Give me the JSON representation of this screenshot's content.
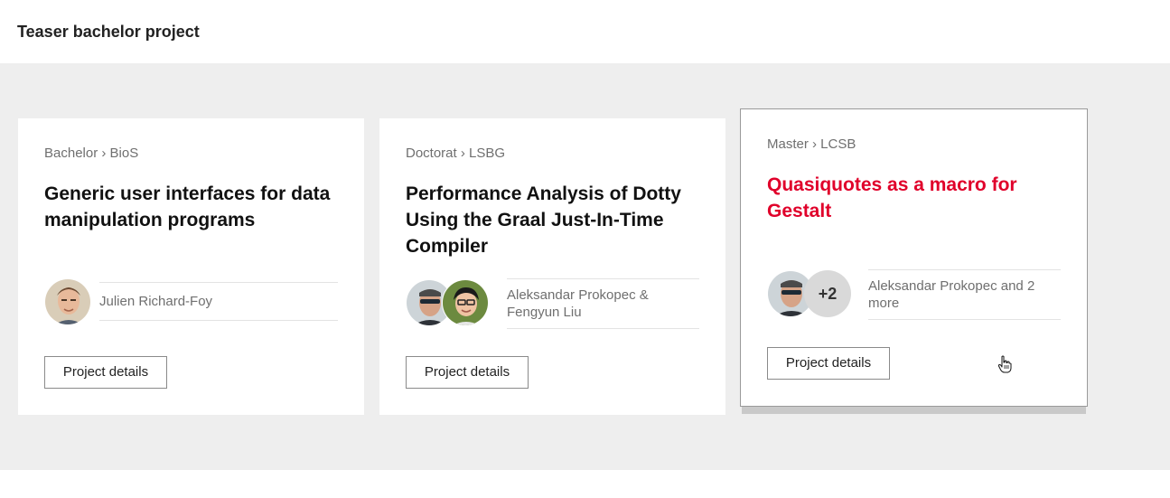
{
  "header": {
    "title": "Teaser bachelor project"
  },
  "cards": [
    {
      "breadcrumb": "Bachelor › BioS",
      "title": "Generic user interfaces for data manipulation programs",
      "people": "Julien Richard-Foy",
      "button": "Project details"
    },
    {
      "breadcrumb": "Doctorat › LSBG",
      "title": "Performance Analysis of Dotty Using the Graal Just-In-Time Compiler",
      "people": "Aleksandar Prokopec & Fengyun Liu",
      "button": "Project details"
    },
    {
      "breadcrumb": "Master › LCSB",
      "title": "Quasiquotes as a macro for Gestalt",
      "people": "Aleksandar Prokopec and 2 more",
      "more_badge": "+2",
      "button": "Project details"
    }
  ],
  "colors": {
    "accent": "#e0002a",
    "band": "#eeeeee"
  },
  "icons": [
    "avatar-photo",
    "pointer-hand-cursor"
  ]
}
